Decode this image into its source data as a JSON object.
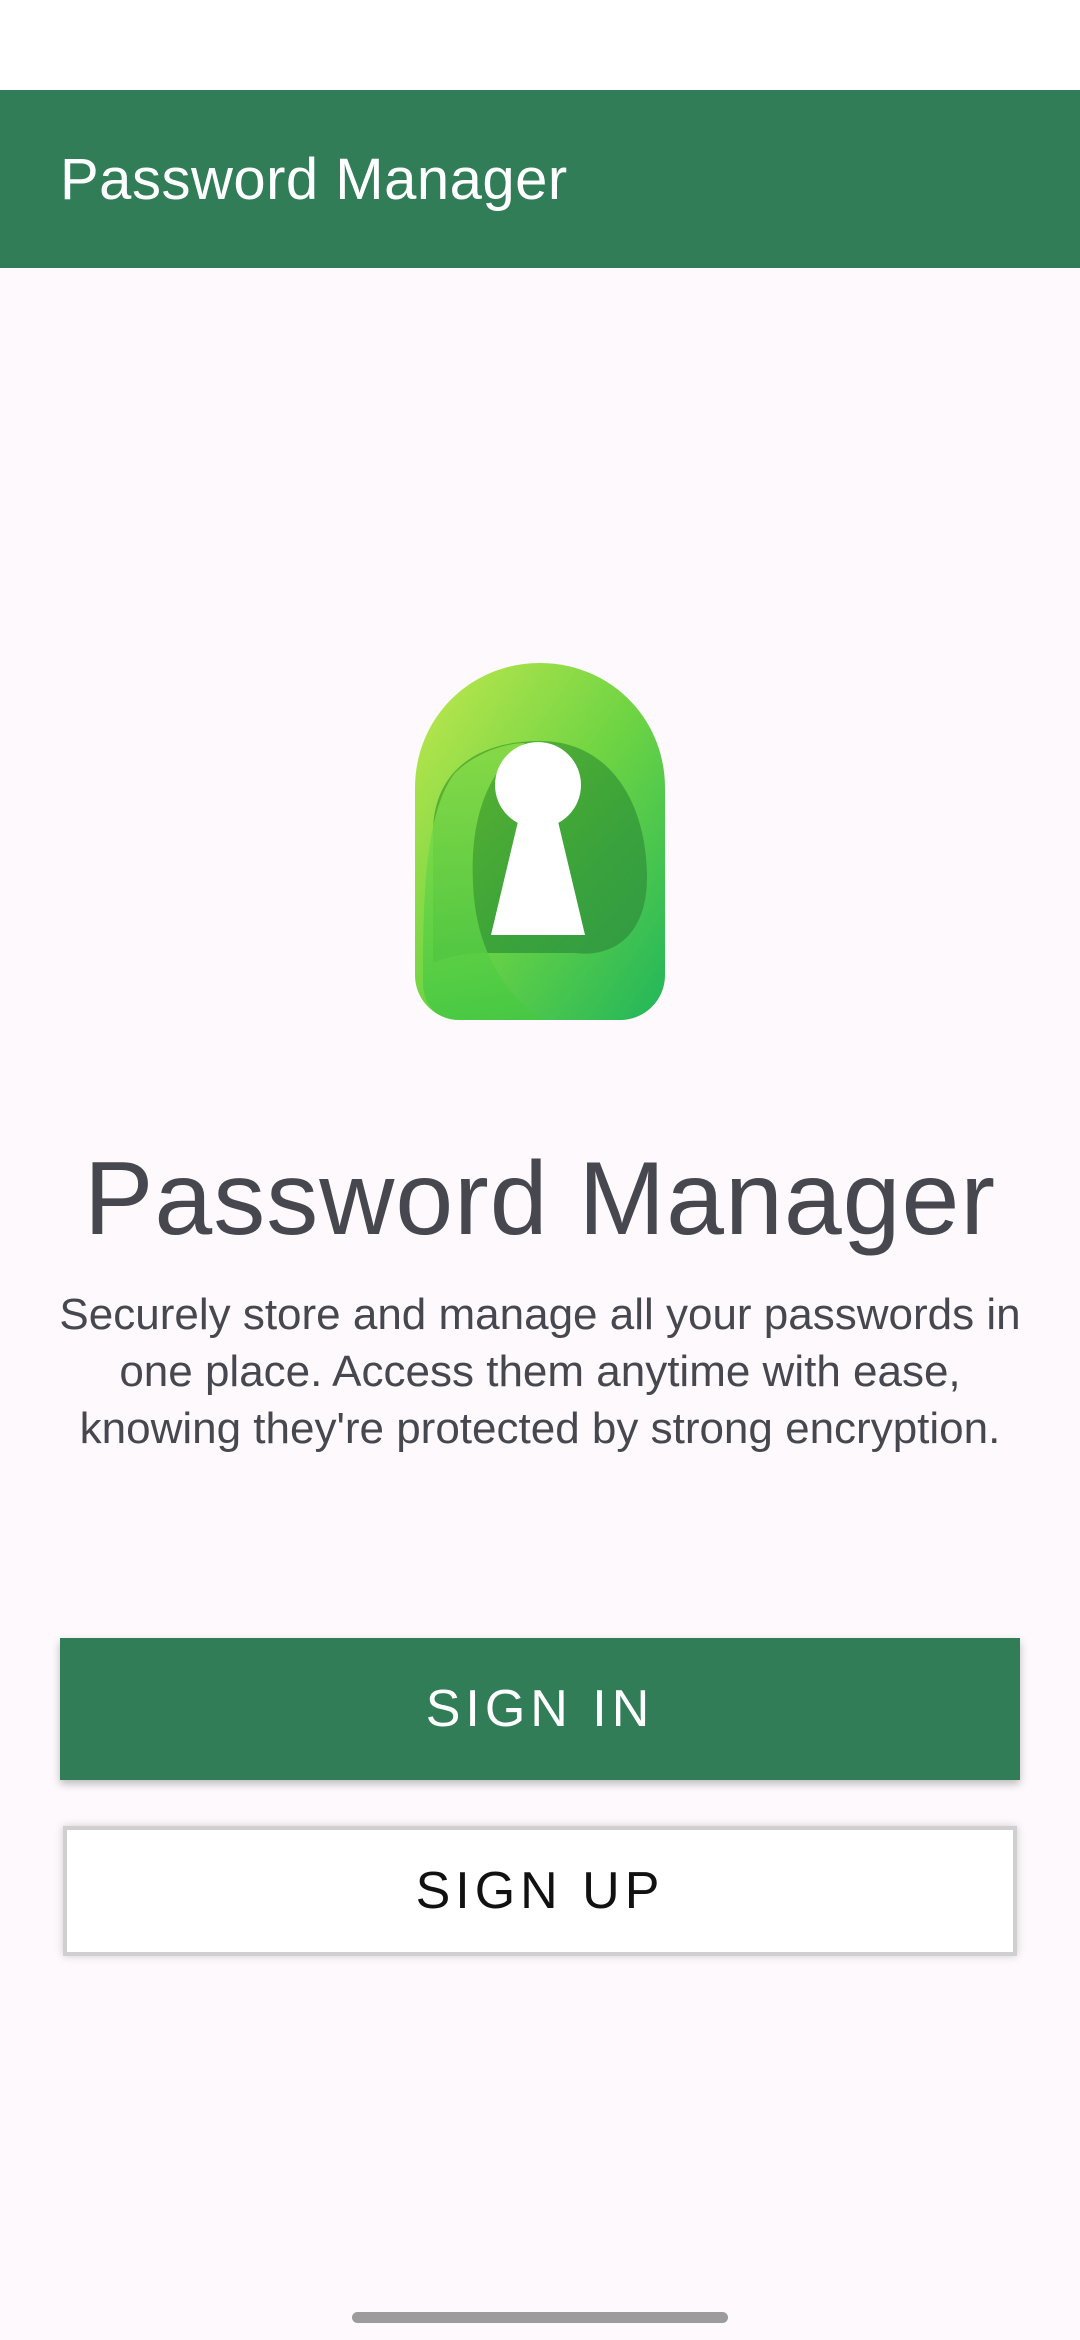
{
  "app_bar": {
    "title": "Password Manager"
  },
  "hero": {
    "logo_icon": "keyhole-lock-icon",
    "title": "Password Manager",
    "description": "Securely store and manage all your passwords in one place. Access them anytime with ease, knowing they're protected by strong encryption."
  },
  "actions": {
    "sign_in_label": "SIGN IN",
    "sign_up_label": "SIGN UP"
  },
  "colors": {
    "primary": "#317d58",
    "background": "#fdf9fc",
    "text": "#47474f"
  }
}
